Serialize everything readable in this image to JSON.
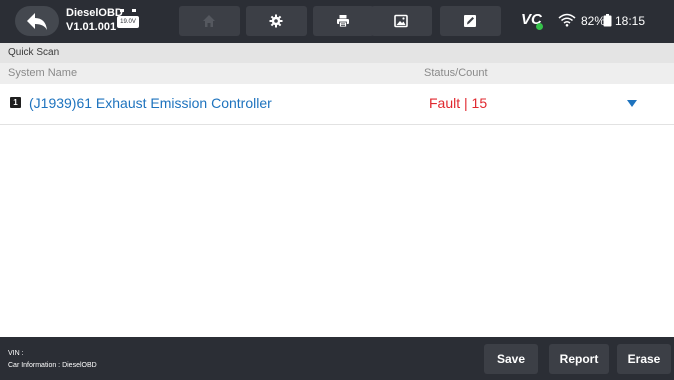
{
  "topbar": {
    "app_name": "DieselOBD",
    "app_version": "V1.01.001",
    "battery_voltage": "19.0V",
    "vci_label": "VC",
    "vci_status_color": "#35c24a",
    "battery_percent": "82%",
    "time": "18:15",
    "toolbar": [
      {
        "name": "home",
        "icon": "home-icon"
      },
      {
        "name": "settings",
        "icon": "gear-icon"
      },
      {
        "name": "print",
        "icon": "printer-icon"
      },
      {
        "name": "screenshot",
        "icon": "image-icon"
      },
      {
        "name": "edit",
        "icon": "edit-icon"
      }
    ]
  },
  "page": {
    "title": "Quick Scan",
    "columns": {
      "system": "System Name",
      "status": "Status/Count"
    }
  },
  "rows": [
    {
      "index": "1",
      "system": "(J1939)61 Exhaust Emission Controller",
      "status": "Fault | 15",
      "status_color": "#e0282f",
      "system_color": "#1e73be"
    }
  ],
  "bottombar": {
    "vin_label": "VIN :",
    "car_info": "Car Information : DieselOBD",
    "buttons": {
      "save": "Save",
      "report": "Report",
      "erase": "Erase"
    }
  },
  "colors": {
    "bar_bg": "#2b2e35",
    "button_bg": "#3c3f46",
    "accent_blue": "#1e73be",
    "fault_red": "#e0282f"
  }
}
